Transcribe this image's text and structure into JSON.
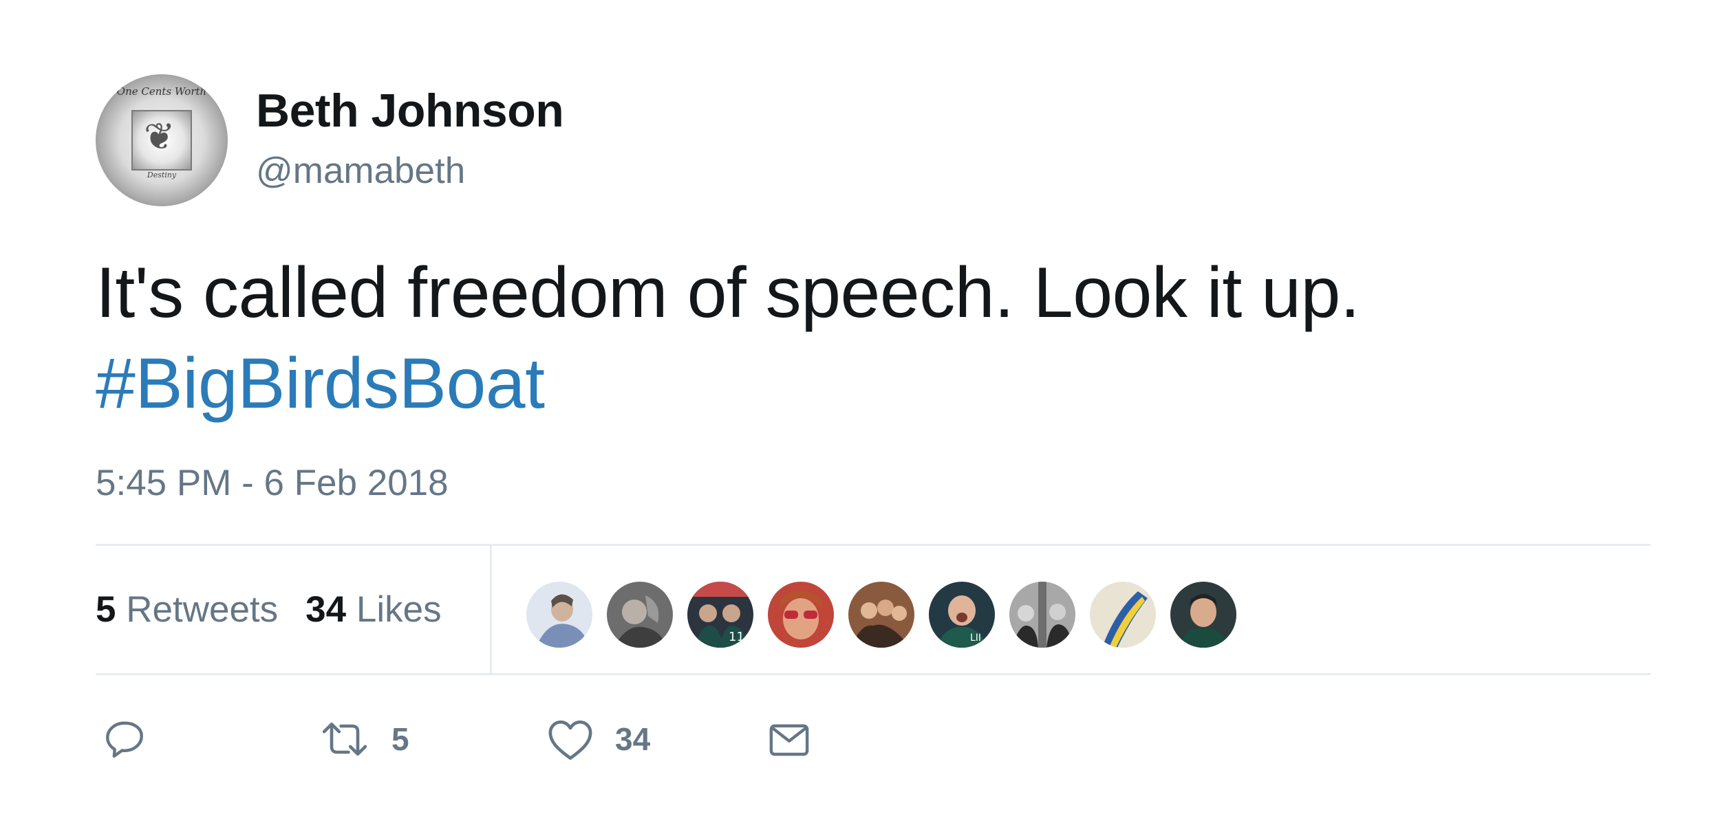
{
  "author": {
    "display_name": "Beth Johnson",
    "handle": "@mamabeth",
    "avatar_text_top": "One Cents Worth",
    "avatar_text_bottom": "Destiny"
  },
  "tweet": {
    "text": "It's called freedom of speech. Look it up.",
    "hashtag": "#BigBirdsBoat",
    "timestamp": "5:45 PM - 6 Feb 2018"
  },
  "stats": {
    "retweets_count": "5",
    "retweets_label": "Retweets",
    "likes_count": "34",
    "likes_label": "Likes"
  },
  "likers": [
    {
      "icon": "user-avatar-1"
    },
    {
      "icon": "user-avatar-2"
    },
    {
      "icon": "user-avatar-3"
    },
    {
      "icon": "user-avatar-4"
    },
    {
      "icon": "user-avatar-5"
    },
    {
      "icon": "user-avatar-6"
    },
    {
      "icon": "user-avatar-7"
    },
    {
      "icon": "user-avatar-8"
    },
    {
      "icon": "user-avatar-9"
    }
  ],
  "actions": {
    "reply_icon": "reply-icon",
    "retweet_icon": "retweet-icon",
    "retweet_count": "5",
    "like_icon": "heart-icon",
    "like_count": "34",
    "dm_icon": "envelope-icon"
  },
  "colors": {
    "text": "#14171a",
    "secondary": "#657786",
    "hashtag": "#2b7bb9",
    "divider": "#e6ecf0"
  }
}
